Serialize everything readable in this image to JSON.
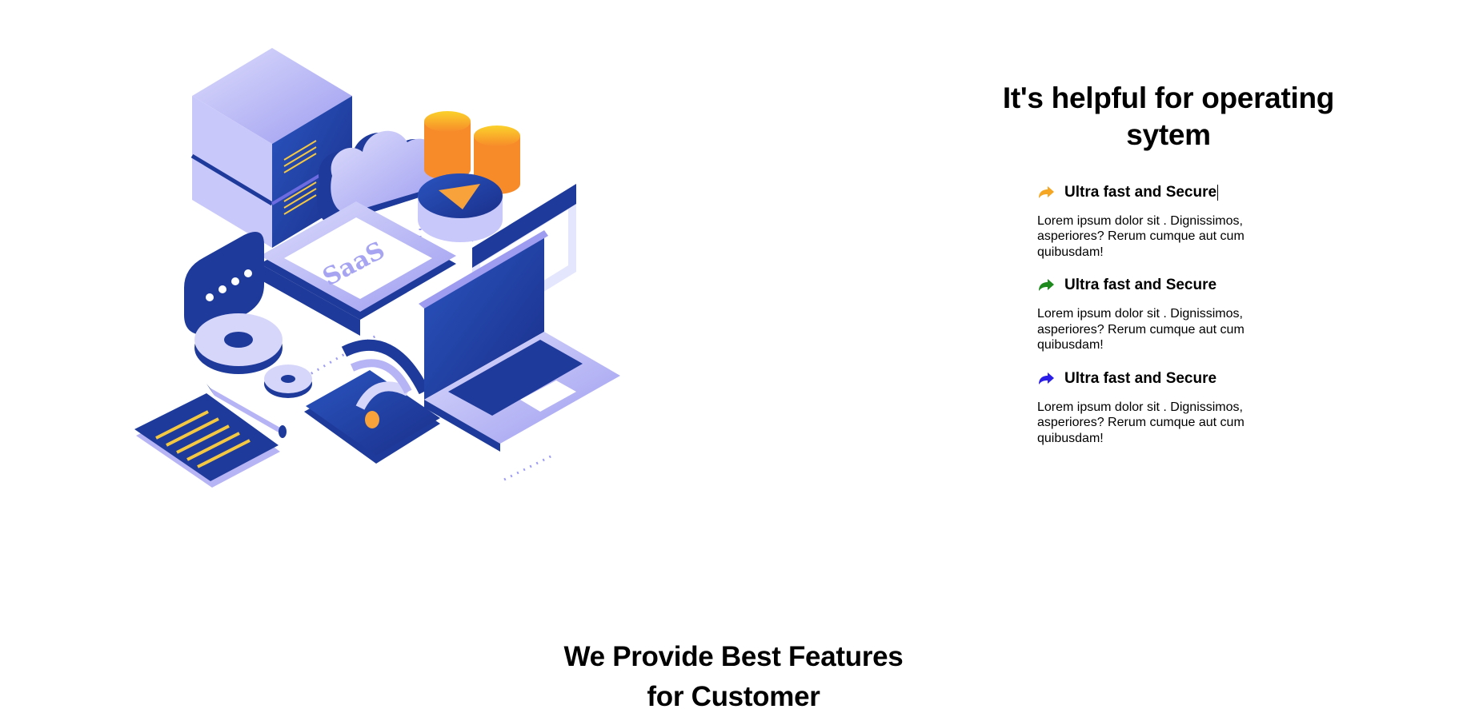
{
  "features": {
    "heading": "It's helpful for operating sytem",
    "items": [
      {
        "title": "Ultra fast and Secure",
        "description": "Lorem ipsum dolor sit . Dignissimos, asperiores? Rerum cumque aut cum quibusdam!",
        "icon": "share-arrow-icon",
        "color": "#f5a623"
      },
      {
        "title": "Ultra fast and Secure",
        "description": "Lorem ipsum dolor sit . Dignissimos, asperiores? Rerum cumque aut cum quibusdam!",
        "icon": "share-arrow-icon",
        "color": "#1e8a1e"
      },
      {
        "title": "Ultra fast and Secure",
        "description": "Lorem ipsum dolor sit . Dignissimos, asperiores? Rerum cumque aut cum quibusdam!",
        "icon": "share-arrow-icon",
        "color": "#2a1ee8"
      }
    ]
  },
  "illustration": {
    "saas_label": "SaaS",
    "colors": {
      "navy": "#1e3a9a",
      "lavender": "#b6b4f5",
      "orange": "#f7a23a",
      "yellow": "#f5c842"
    }
  },
  "section": {
    "title_line1": "We Provide Best Features",
    "title_line2": "for Customer"
  }
}
